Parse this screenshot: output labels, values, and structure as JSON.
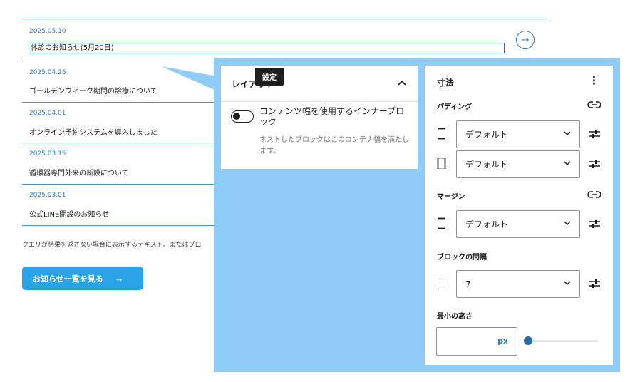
{
  "news": {
    "items": [
      {
        "date": "2025.05.10",
        "title": "休診のお知らせ(5月20日)"
      },
      {
        "date": "2025.04.25",
        "title": "ゴールデンウィーク期間の診療について"
      },
      {
        "date": "2025.04.01",
        "title": "オンライン予約システムを導入しました"
      },
      {
        "date": "2025.03.15",
        "title": "循環器専門外来の新設について"
      },
      {
        "date": "2025.03.01",
        "title": "公式LINE開設のお知らせ"
      }
    ],
    "arrow": "→",
    "empty_text": "クエリが結果を返さない場合に表示するテキスト、またはブロ",
    "more_button": "お知らせ一覧を見る",
    "more_arrow": "→"
  },
  "tooltip": "設定",
  "layout_panel": {
    "title": "レイアウト",
    "toggle_label": "コンテンツ幅を使用するインナーブロック",
    "toggle_help": "ネストしたブロックはこのコンテナ幅を満たします。",
    "toggle_on": false
  },
  "dimensions_panel": {
    "title": "寸法",
    "padding_label": "パディング",
    "padding_vertical": "デフォルト",
    "padding_horizontal": "デフォルト",
    "margin_label": "マージン",
    "margin_value": "デフォルト",
    "block_spacing_label": "ブロックの間隔",
    "block_spacing_value": "7",
    "min_height_label": "最小の高さ",
    "min_height_unit": "px",
    "min_height_value": ""
  },
  "colors": {
    "accent": "#29a3e6",
    "overlay": "#8fcdf6",
    "link_blue": "#2a7fc1"
  }
}
